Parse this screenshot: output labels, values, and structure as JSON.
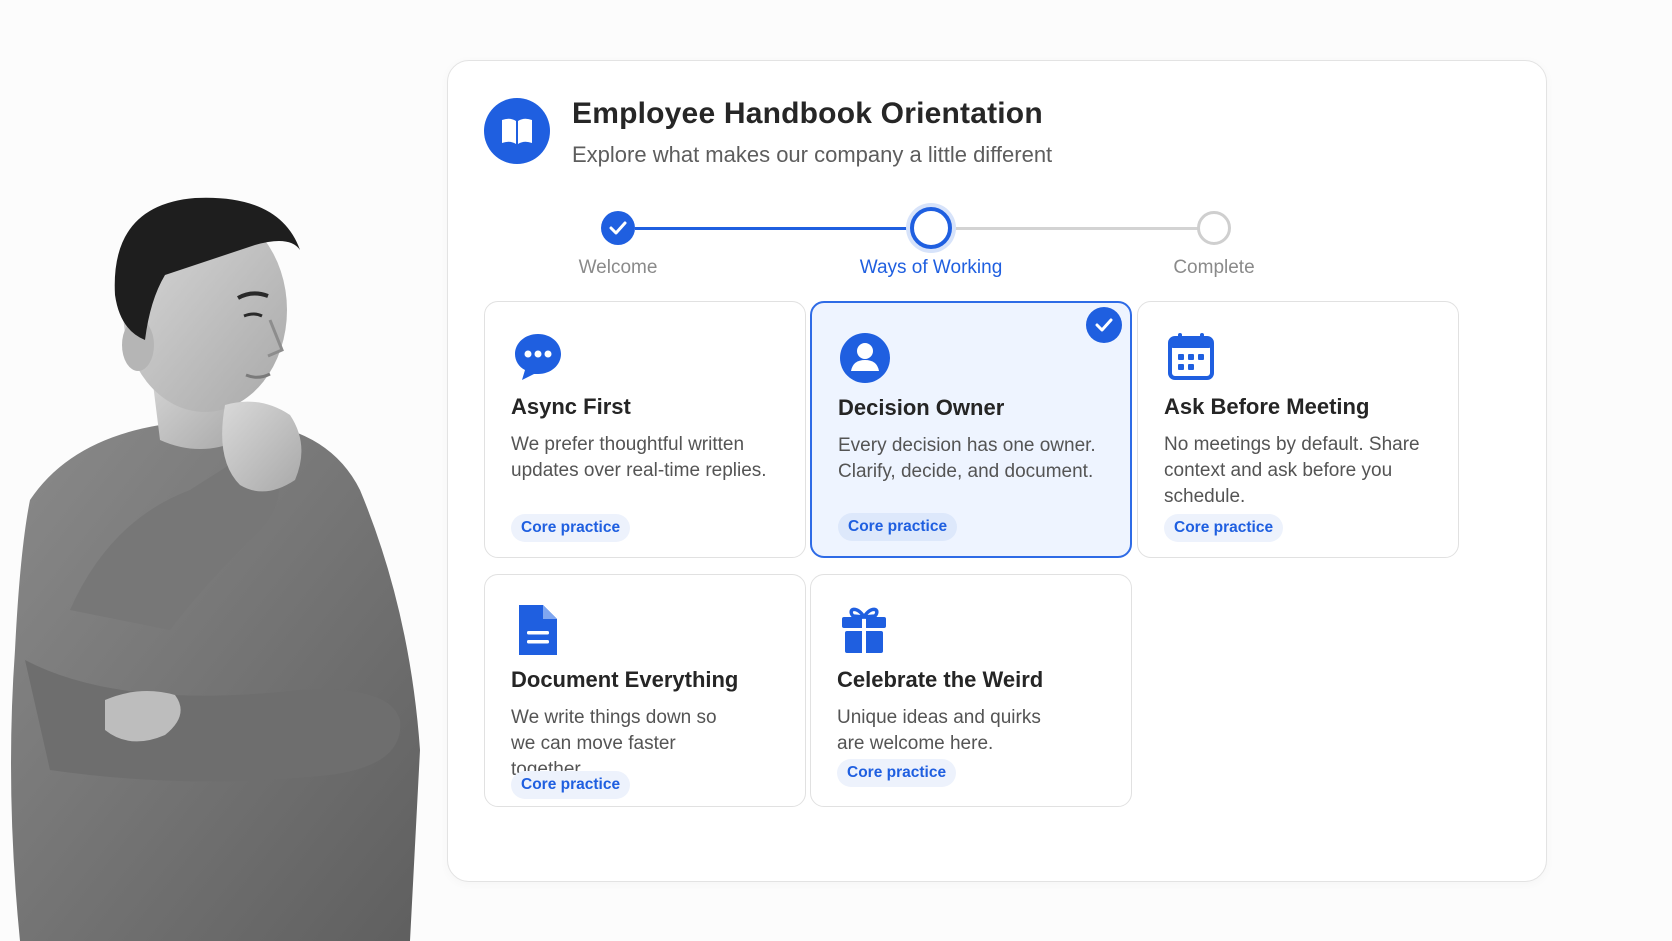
{
  "header": {
    "title": "Employee Handbook Orientation",
    "subtitle": "Explore what makes our company a little different",
    "logo_icon": "book-icon"
  },
  "stepper": {
    "steps": [
      {
        "label": "Welcome",
        "state": "completed"
      },
      {
        "label": "Ways of Working",
        "state": "current"
      },
      {
        "label": "Complete",
        "state": "upcoming"
      }
    ]
  },
  "cards": [
    {
      "title": "Async First",
      "description": "We prefer thoughtful written updates over real-time replies.",
      "badge": "Core practice",
      "icon": "chat-bubble-icon",
      "selected": false
    },
    {
      "title": "Decision Owner",
      "description": "Every decision has one owner. Clarify, decide, and document.",
      "badge": "Core practice",
      "icon": "user-icon",
      "selected": true
    },
    {
      "title": "Ask Before Meeting",
      "description": "No meetings by default. Share context and ask before you schedule.",
      "badge": "Core practice",
      "icon": "calendar-icon",
      "selected": false
    },
    {
      "title": "Document Everything",
      "description": "We write things down so we can move faster together.",
      "badge": "Core practice",
      "icon": "document-icon",
      "selected": false
    },
    {
      "title": "Celebrate the Weird",
      "description": "Unique ideas and quirks are welcome here.",
      "badge": "Core practice",
      "icon": "gift-icon",
      "selected": false
    }
  ],
  "colors": {
    "accent": "#1f5fe0",
    "selected_bg": "#eef4ff",
    "muted_text": "#8a8a8a"
  }
}
